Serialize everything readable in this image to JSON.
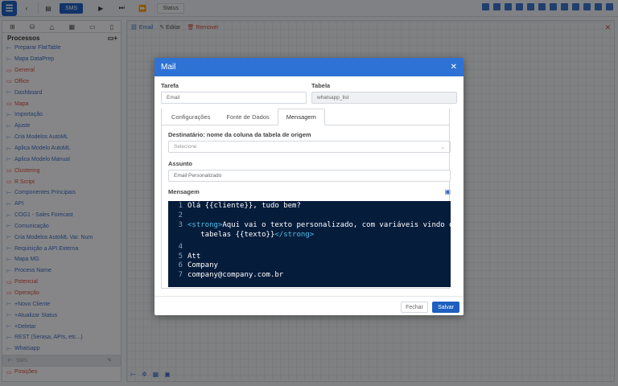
{
  "toolbar": {
    "active_label": "SMS",
    "status_label": "Status"
  },
  "left": {
    "title": "Processos",
    "items": [
      {
        "label": "Preparar FlatTable",
        "red": false
      },
      {
        "label": "Mapa DataPrep",
        "red": false
      },
      {
        "label": "General",
        "red": true
      },
      {
        "label": "Office",
        "red": true
      },
      {
        "label": "Dashboard",
        "red": false
      },
      {
        "label": "Mapa",
        "red": true
      },
      {
        "label": "Importação",
        "red": false
      },
      {
        "label": "Ajuste",
        "red": false
      },
      {
        "label": "Cria Modelos AutoML",
        "red": false
      },
      {
        "label": "Aplica Modelo AutoML",
        "red": false
      },
      {
        "label": "Aplica Modelo Manual",
        "red": false
      },
      {
        "label": "Clustering",
        "red": true
      },
      {
        "label": "R Script",
        "red": true
      },
      {
        "label": "Componentes Principais",
        "red": false
      },
      {
        "label": "API",
        "red": false
      },
      {
        "label": "COG1 - Sales Forecast",
        "red": false
      },
      {
        "label": "Comunicação",
        "red": false
      },
      {
        "label": "Cria Modelos AutoML Var. Num",
        "red": false
      },
      {
        "label": "Requisição a API Externa",
        "red": false
      },
      {
        "label": "Mapa MG",
        "red": false
      },
      {
        "label": "Process Name",
        "red": false
      },
      {
        "label": "Potencial",
        "red": true
      },
      {
        "label": "Operação",
        "red": true
      },
      {
        "label": "+Novo Cliente",
        "red": false
      },
      {
        "label": "+Atualizar Status",
        "red": false
      },
      {
        "label": "+Deletar",
        "red": false
      },
      {
        "label": "REST (Serasa, APIs, etc...)",
        "red": false
      },
      {
        "label": "Whatsapp",
        "red": false
      },
      {
        "label": "SMS",
        "red": false,
        "selected": true
      },
      {
        "label": "Posições",
        "red": true
      }
    ]
  },
  "canvas": {
    "email": "Email",
    "edit": "Editar",
    "remove": "Remover"
  },
  "modal": {
    "title": "Mail",
    "tarefa_label": "Tarefa",
    "tarefa_value": "Email",
    "tabela_label": "Tabela",
    "tabela_value": "whatsapp_list",
    "tabs": [
      "Configurações",
      "Fonte de Dados",
      "Mensagem"
    ],
    "dest_label": "Destinatário: nome da coluna da tabela de origem",
    "dest_placeholder": "Selecione",
    "assunto_label": "Assunto",
    "assunto_value": "Email Personalizado",
    "mensagem_label": "Mensagem",
    "code": {
      "l1": "Olá {{cliente}}, tudo bem?",
      "l3_open": "<strong>",
      "l3_text": "Aqui vai o texto personalizado, com variáveis vindo de",
      "l3b_text": "   tabelas {{texto}}",
      "l3_close": "</strong>",
      "l5": "Att",
      "l6": "Company",
      "l7": "company@company.com.br"
    },
    "fechar": "Fechar",
    "salvar": "Salvar"
  }
}
